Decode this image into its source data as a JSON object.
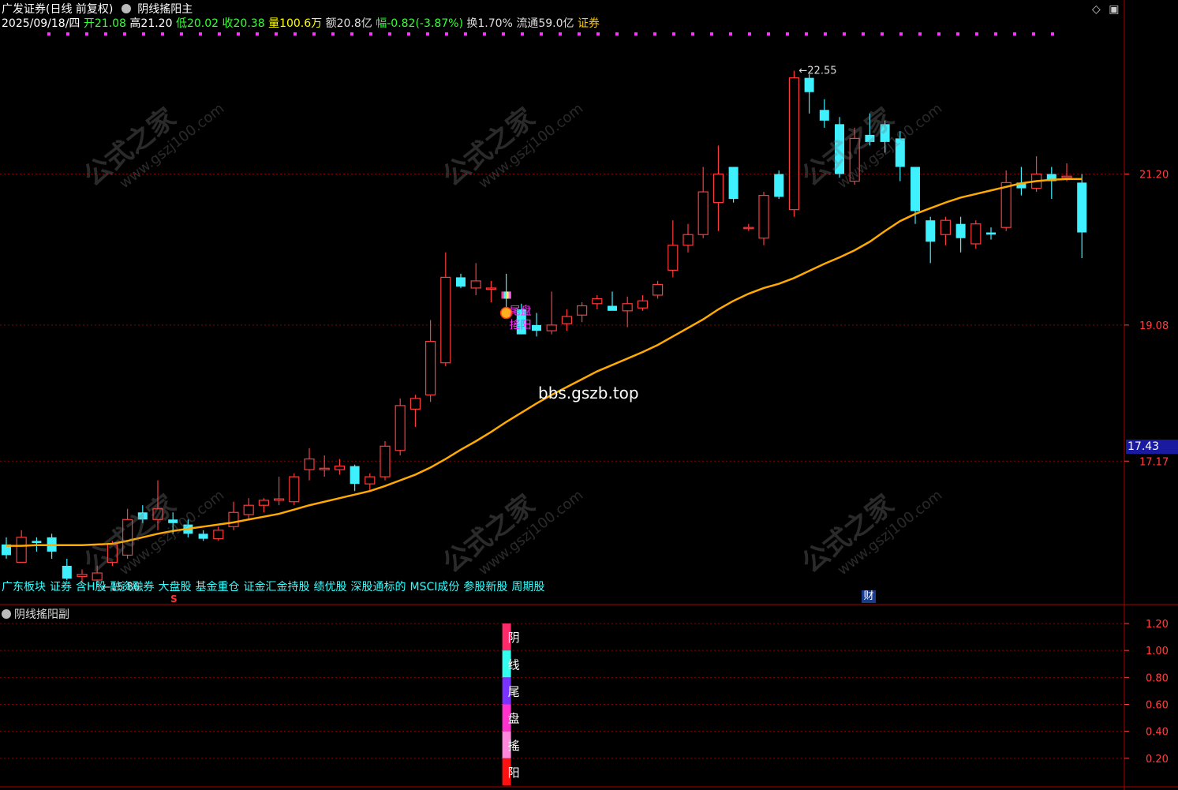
{
  "header": {
    "app_title": "广发证券(日线 前复权)",
    "indicator_main": "阴线搖阳主",
    "date": "2025/09/18/四",
    "open_label": "开",
    "open": "21.08",
    "high_label": "高",
    "high": "21.20",
    "low_label": "低",
    "low": "20.02",
    "close_label": "收",
    "close": "20.38",
    "vol_label": "量",
    "volume": "100.6万",
    "amt_label": "额",
    "amount": "20.8亿",
    "chg_label": "幅",
    "change": "-0.82(-3.87%)",
    "turn_label": "换",
    "turnover": "1.70%",
    "float_label": "流通",
    "float_cap": "59.0亿",
    "sector": "证券"
  },
  "tags": [
    "广东板块",
    "证券",
    "含H股",
    "融资融券",
    "大盘股",
    "基金重仓",
    "证金汇金持股",
    "绩优股",
    "深股通标的",
    "MSCI成份",
    "参股新股",
    "周期股"
  ],
  "sub_panel": {
    "title": "阴线搖阳副",
    "chars": [
      "阴",
      "线",
      "尾",
      "盘",
      "搖",
      "阳"
    ]
  },
  "annotations": {
    "high_mark": "22.55",
    "low_mark": "15.86",
    "signal_text_1": "尾盘",
    "signal_text_2": "搖阳",
    "bbs": "bbs.gszb.top",
    "current_price": "17.43",
    "cai_icon": "财",
    "s_icon": "S"
  },
  "watermark": {
    "cn": "公式之家",
    "url": "www.gszj100.com"
  },
  "colors": {
    "up": "#ff3a3a",
    "down": "#3ff0ff",
    "ma": "#ffaa00",
    "grid": "#8a0000",
    "axis_text": "#ff4040",
    "magenta": "#ff33ff"
  },
  "chart_data": {
    "type": "candlestick",
    "y_ticks": [
      "21.20",
      "19.08",
      "17.17"
    ],
    "sub_y_ticks": [
      "1.20",
      "1.00",
      "0.80",
      "0.60",
      "0.40",
      "0.20"
    ],
    "ylim": [
      15.5,
      23.2
    ],
    "candles": [
      {
        "o": 16.0,
        "h": 16.1,
        "l": 15.8,
        "c": 15.85
      },
      {
        "o": 15.75,
        "h": 16.2,
        "l": 15.75,
        "c": 16.1
      },
      {
        "o": 16.05,
        "h": 16.1,
        "l": 15.9,
        "c": 16.02
      },
      {
        "o": 16.1,
        "h": 16.15,
        "l": 15.8,
        "c": 15.9
      },
      {
        "o": 15.7,
        "h": 15.8,
        "l": 15.5,
        "c": 15.52
      },
      {
        "o": 15.55,
        "h": 15.65,
        "l": 15.45,
        "c": 15.58
      },
      {
        "o": 15.5,
        "h": 15.7,
        "l": 15.4,
        "c": 15.6
      },
      {
        "o": 15.75,
        "h": 16.05,
        "l": 15.7,
        "c": 16.0
      },
      {
        "o": 15.85,
        "h": 16.5,
        "l": 15.8,
        "c": 16.35
      },
      {
        "o": 16.45,
        "h": 16.55,
        "l": 16.3,
        "c": 16.35
      },
      {
        "o": 16.35,
        "h": 16.9,
        "l": 16.2,
        "c": 16.5
      },
      {
        "o": 16.35,
        "h": 16.45,
        "l": 16.15,
        "c": 16.3
      },
      {
        "o": 16.28,
        "h": 16.35,
        "l": 16.1,
        "c": 16.15
      },
      {
        "o": 16.15,
        "h": 16.2,
        "l": 16.05,
        "c": 16.08
      },
      {
        "o": 16.08,
        "h": 16.25,
        "l": 16.05,
        "c": 16.2
      },
      {
        "o": 16.25,
        "h": 16.6,
        "l": 16.2,
        "c": 16.45
      },
      {
        "o": 16.42,
        "h": 16.65,
        "l": 16.35,
        "c": 16.55
      },
      {
        "o": 16.55,
        "h": 16.65,
        "l": 16.45,
        "c": 16.62
      },
      {
        "o": 16.62,
        "h": 16.95,
        "l": 16.55,
        "c": 16.64
      },
      {
        "o": 16.6,
        "h": 17.0,
        "l": 16.55,
        "c": 16.95
      },
      {
        "o": 17.05,
        "h": 17.35,
        "l": 16.9,
        "c": 17.2
      },
      {
        "o": 17.05,
        "h": 17.25,
        "l": 16.95,
        "c": 17.07
      },
      {
        "o": 17.05,
        "h": 17.2,
        "l": 16.98,
        "c": 17.1
      },
      {
        "o": 17.1,
        "h": 17.12,
        "l": 16.75,
        "c": 16.85
      },
      {
        "o": 16.85,
        "h": 17.0,
        "l": 16.75,
        "c": 16.95
      },
      {
        "o": 16.95,
        "h": 17.45,
        "l": 16.9,
        "c": 17.38
      },
      {
        "o": 17.32,
        "h": 18.05,
        "l": 17.25,
        "c": 17.95
      },
      {
        "o": 17.9,
        "h": 18.1,
        "l": 17.65,
        "c": 18.05
      },
      {
        "o": 18.1,
        "h": 19.15,
        "l": 18.0,
        "c": 18.85
      },
      {
        "o": 18.55,
        "h": 20.1,
        "l": 18.5,
        "c": 19.75
      },
      {
        "o": 19.75,
        "h": 19.8,
        "l": 19.6,
        "c": 19.62
      },
      {
        "o": 19.6,
        "h": 19.95,
        "l": 19.5,
        "c": 19.7
      },
      {
        "o": 19.6,
        "h": 19.7,
        "l": 19.4,
        "c": 19.6
      },
      {
        "o": 19.55,
        "h": 19.8,
        "l": 19.25,
        "c": 19.45
      },
      {
        "o": 19.3,
        "h": 19.38,
        "l": 18.95,
        "c": 18.95
      },
      {
        "o": 19.08,
        "h": 19.25,
        "l": 18.92,
        "c": 19.0
      },
      {
        "o": 19.0,
        "h": 19.55,
        "l": 18.95,
        "c": 19.08
      },
      {
        "o": 19.1,
        "h": 19.3,
        "l": 19.0,
        "c": 19.2
      },
      {
        "o": 19.22,
        "h": 19.4,
        "l": 19.12,
        "c": 19.35
      },
      {
        "o": 19.38,
        "h": 19.5,
        "l": 19.3,
        "c": 19.45
      },
      {
        "o": 19.35,
        "h": 19.55,
        "l": 19.3,
        "c": 19.28
      },
      {
        "o": 19.28,
        "h": 19.48,
        "l": 19.05,
        "c": 19.38
      },
      {
        "o": 19.32,
        "h": 19.5,
        "l": 19.28,
        "c": 19.42
      },
      {
        "o": 19.5,
        "h": 19.7,
        "l": 19.45,
        "c": 19.65
      },
      {
        "o": 19.85,
        "h": 20.55,
        "l": 19.75,
        "c": 20.2
      },
      {
        "o": 20.2,
        "h": 20.5,
        "l": 20.1,
        "c": 20.35
      },
      {
        "o": 20.35,
        "h": 21.3,
        "l": 20.3,
        "c": 20.95
      },
      {
        "o": 20.8,
        "h": 21.6,
        "l": 20.4,
        "c": 21.2
      },
      {
        "o": 21.3,
        "h": 21.3,
        "l": 20.8,
        "c": 20.85
      },
      {
        "o": 20.45,
        "h": 20.5,
        "l": 20.4,
        "c": 20.45
      },
      {
        "o": 20.3,
        "h": 20.95,
        "l": 20.2,
        "c": 20.9
      },
      {
        "o": 21.2,
        "h": 21.25,
        "l": 20.85,
        "c": 20.88
      },
      {
        "o": 20.7,
        "h": 22.65,
        "l": 20.6,
        "c": 22.55
      },
      {
        "o": 22.55,
        "h": 22.6,
        "l": 22.05,
        "c": 22.35
      },
      {
        "o": 22.1,
        "h": 22.25,
        "l": 21.85,
        "c": 21.95
      },
      {
        "o": 21.9,
        "h": 22.0,
        "l": 21.15,
        "c": 21.2
      },
      {
        "o": 21.1,
        "h": 21.85,
        "l": 21.05,
        "c": 21.7
      },
      {
        "o": 21.75,
        "h": 22.05,
        "l": 21.6,
        "c": 21.65
      },
      {
        "o": 21.9,
        "h": 21.95,
        "l": 21.5,
        "c": 21.65
      },
      {
        "o": 21.7,
        "h": 21.8,
        "l": 21.1,
        "c": 21.3
      },
      {
        "o": 21.3,
        "h": 21.3,
        "l": 20.5,
        "c": 20.68
      },
      {
        "o": 20.55,
        "h": 20.6,
        "l": 19.95,
        "c": 20.25
      },
      {
        "o": 20.35,
        "h": 20.6,
        "l": 20.2,
        "c": 20.55
      },
      {
        "o": 20.5,
        "h": 20.6,
        "l": 20.1,
        "c": 20.3
      },
      {
        "o": 20.22,
        "h": 20.55,
        "l": 20.15,
        "c": 20.5
      },
      {
        "o": 20.38,
        "h": 20.45,
        "l": 20.28,
        "c": 20.35
      },
      {
        "o": 20.45,
        "h": 21.25,
        "l": 20.4,
        "c": 21.08
      },
      {
        "o": 21.08,
        "h": 21.3,
        "l": 20.9,
        "c": 21.0
      },
      {
        "o": 21.0,
        "h": 21.45,
        "l": 20.95,
        "c": 21.2
      },
      {
        "o": 21.2,
        "h": 21.3,
        "l": 20.85,
        "c": 21.1
      },
      {
        "o": 21.15,
        "h": 21.35,
        "l": 21.1,
        "c": 21.17
      },
      {
        "o": 21.08,
        "h": 21.2,
        "l": 20.02,
        "c": 20.38
      }
    ],
    "ma": [
      15.98,
      15.98,
      15.99,
      15.99,
      15.99,
      15.99,
      16.0,
      16.01,
      16.05,
      16.1,
      16.15,
      16.19,
      16.22,
      16.25,
      16.28,
      16.31,
      16.35,
      16.39,
      16.43,
      16.49,
      16.55,
      16.6,
      16.65,
      16.7,
      16.75,
      16.82,
      16.9,
      16.98,
      17.08,
      17.2,
      17.33,
      17.45,
      17.58,
      17.72,
      17.85,
      17.98,
      18.1,
      18.21,
      18.32,
      18.43,
      18.52,
      18.61,
      18.7,
      18.8,
      18.92,
      19.04,
      19.16,
      19.3,
      19.42,
      19.52,
      19.6,
      19.66,
      19.74,
      19.84,
      19.94,
      20.03,
      20.13,
      20.25,
      20.4,
      20.54,
      20.64,
      20.72,
      20.8,
      20.87,
      20.92,
      20.97,
      21.02,
      21.07,
      21.1,
      21.12,
      21.13,
      21.13
    ],
    "signal_index": 33
  }
}
